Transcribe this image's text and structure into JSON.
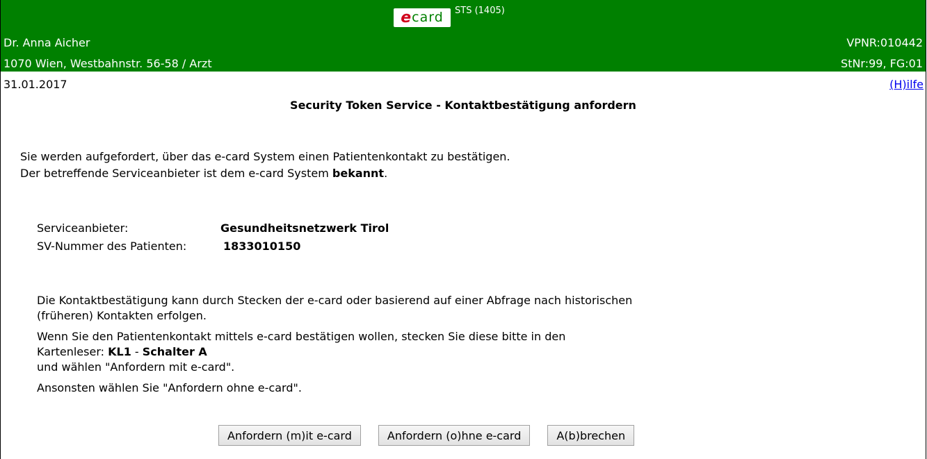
{
  "header": {
    "logo_e": "e",
    "logo_card": "card",
    "app_code": "STS (1405)",
    "doctor_name": "Dr. Anna Aicher",
    "vpnr": "VPNR:010442",
    "address": "1070 Wien, Westbahnstr. 56-58 / Arzt",
    "stnr_fg": "StNr:99, FG:01",
    "bg_color": "#008000"
  },
  "date": "31.01.2017",
  "help_link": "(H)ilfe",
  "page_title": "Security Token Service - Kontaktbestätigung anfordern",
  "intro": {
    "line1": "Sie werden aufgefordert, über das e-card System einen Patientenkontakt zu bestätigen.",
    "line2_prefix": "Der betreffende Serviceanbieter ist dem e-card System ",
    "line2_bold": "bekannt",
    "line2_suffix": "."
  },
  "info": {
    "provider_label": "Serviceanbieter:",
    "provider_value": "Gesundheitsnetzwerk Tirol",
    "svnr_label": "SV-Nummer des Patienten:",
    "svnr_value": "1833010150"
  },
  "instructions": {
    "line1": "Die Kontaktbestätigung kann durch Stecken der e-card oder basierend auf einer Abfrage nach historischen",
    "line2": "(früheren) Kontakten erfolgen.",
    "line3": "Wenn Sie den Patientenkontakt mittels e-card bestätigen wollen, stecken Sie diese bitte in den",
    "reader_prefix": "Kartenleser: ",
    "reader_name": "KL1",
    "reader_sep": " - ",
    "reader_slot": "Schalter A",
    "line5": "und wählen \"Anfordern mit e-card\".",
    "line6": "Ansonsten wählen Sie \"Anfordern ohne e-card\"."
  },
  "buttons": {
    "with_card": "Anfordern (m)it e-card",
    "without_card": "Anfordern (o)hne e-card",
    "cancel": "A(b)brechen"
  }
}
